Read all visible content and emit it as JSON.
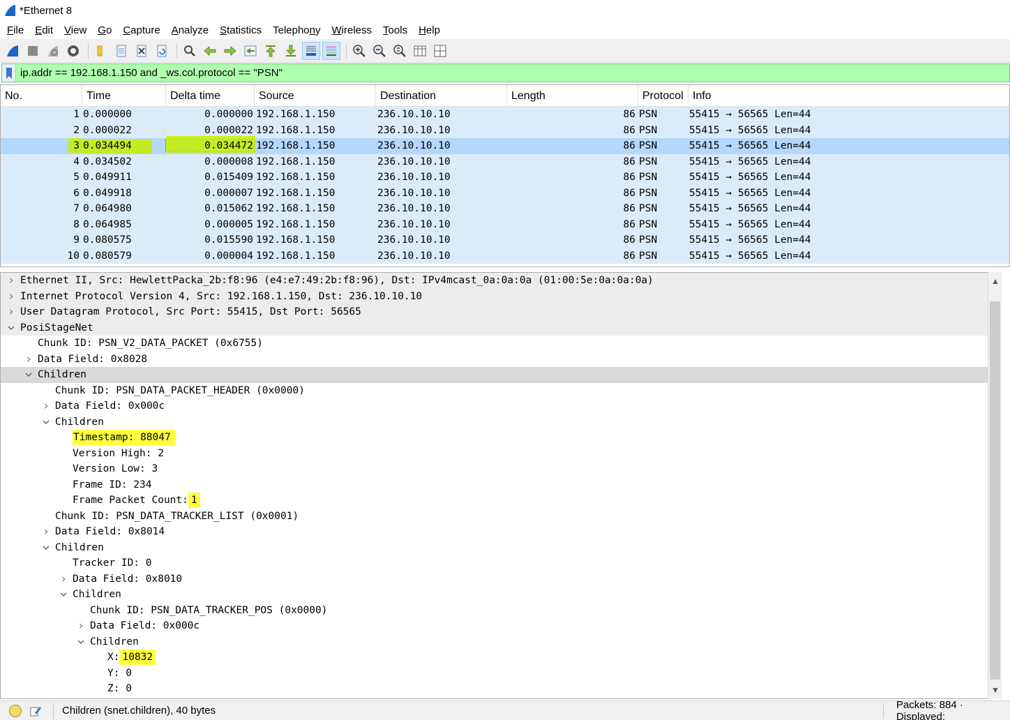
{
  "window": {
    "title": "*Ethernet 8"
  },
  "menu": [
    "File",
    "Edit",
    "View",
    "Go",
    "Capture",
    "Analyze",
    "Statistics",
    "Telephony",
    "Wireless",
    "Tools",
    "Help"
  ],
  "menu_accel": [
    "F",
    "E",
    "V",
    "G",
    "C",
    "A",
    "S",
    "n",
    "W",
    "T",
    "H"
  ],
  "toolbar": [
    "start-capture-icon",
    "stop-capture-icon",
    "restart-capture-icon",
    "capture-options-icon",
    "open-file-icon",
    "save-file-icon",
    "close-file-icon",
    "reload-file-icon",
    "find-packet-icon",
    "go-back-icon",
    "go-forward-icon",
    "go-to-packet-icon",
    "go-first-icon",
    "go-last-icon",
    "autoscroll-icon",
    "colorize-icon",
    "zoom-in-icon",
    "zoom-out-icon",
    "zoom-normal-icon",
    "resize-columns-icon",
    "expand-subtrees-icon"
  ],
  "filter": {
    "text": "ip.addr ==  192.168.1.150 and _ws.col.protocol == \"PSN\""
  },
  "packet_list": {
    "columns": [
      "No.",
      "Time",
      "Delta time",
      "Source",
      "Destination",
      "Length",
      "Protocol",
      "Info"
    ],
    "rows": [
      {
        "no": "1",
        "time": "0.000000",
        "delta": "0.000000",
        "src": "192.168.1.150",
        "dst": "236.10.10.10",
        "len": "86",
        "proto": "PSN",
        "info": "55415 → 56565 Len=44"
      },
      {
        "no": "2",
        "time": "0.000022",
        "delta": "0.000022",
        "src": "192.168.1.150",
        "dst": "236.10.10.10",
        "len": "86",
        "proto": "PSN",
        "info": "55415 → 56565 Len=44"
      },
      {
        "no": "3",
        "time": "0.034494",
        "delta": "0.034472",
        "src": "192.168.1.150",
        "dst": "236.10.10.10",
        "len": "86",
        "proto": "PSN",
        "info": "55415 → 56565 Len=44"
      },
      {
        "no": "4",
        "time": "0.034502",
        "delta": "0.000008",
        "src": "192.168.1.150",
        "dst": "236.10.10.10",
        "len": "86",
        "proto": "PSN",
        "info": "55415 → 56565 Len=44"
      },
      {
        "no": "5",
        "time": "0.049911",
        "delta": "0.015409",
        "src": "192.168.1.150",
        "dst": "236.10.10.10",
        "len": "86",
        "proto": "PSN",
        "info": "55415 → 56565 Len=44"
      },
      {
        "no": "6",
        "time": "0.049918",
        "delta": "0.000007",
        "src": "192.168.1.150",
        "dst": "236.10.10.10",
        "len": "86",
        "proto": "PSN",
        "info": "55415 → 56565 Len=44"
      },
      {
        "no": "7",
        "time": "0.064980",
        "delta": "0.015062",
        "src": "192.168.1.150",
        "dst": "236.10.10.10",
        "len": "86",
        "proto": "PSN",
        "info": "55415 → 56565 Len=44"
      },
      {
        "no": "8",
        "time": "0.064985",
        "delta": "0.000005",
        "src": "192.168.1.150",
        "dst": "236.10.10.10",
        "len": "86",
        "proto": "PSN",
        "info": "55415 → 56565 Len=44"
      },
      {
        "no": "9",
        "time": "0.080575",
        "delta": "0.015590",
        "src": "192.168.1.150",
        "dst": "236.10.10.10",
        "len": "86",
        "proto": "PSN",
        "info": "55415 → 56565 Len=44"
      },
      {
        "no": "10",
        "time": "0.080579",
        "delta": "0.000004",
        "src": "192.168.1.150",
        "dst": "236.10.10.10",
        "len": "86",
        "proto": "PSN",
        "info": "55415 → 56565 Len=44"
      }
    ],
    "selected_index": 2
  },
  "details": [
    {
      "text": "Ethernet II, Src: HewlettPacka_2b:f8:96 (e4:e7:49:2b:f8:96), Dst: IPv4mcast_0a:0a:0a (01:00:5e:0a:0a:0a)",
      "level": 0,
      "arrow": "collapsed",
      "top": true
    },
    {
      "text": "Internet Protocol Version 4, Src: 192.168.1.150, Dst: 236.10.10.10",
      "level": 0,
      "arrow": "collapsed",
      "top": true
    },
    {
      "text": "User Datagram Protocol, Src Port: 55415, Dst Port: 56565",
      "level": 0,
      "arrow": "collapsed",
      "top": true
    },
    {
      "text": "PosiStageNet",
      "level": 0,
      "arrow": "expanded",
      "top": true
    },
    {
      "text": "Chunk ID: PSN_V2_DATA_PACKET (0x6755)",
      "level": 1,
      "arrow": "none"
    },
    {
      "text": "Data Field: 0x8028",
      "level": 1,
      "arrow": "collapsed"
    },
    {
      "text": "Children",
      "level": 1,
      "arrow": "expanded",
      "selected": true
    },
    {
      "text": "Chunk ID: PSN_DATA_PACKET_HEADER (0x0000)",
      "level": 2,
      "arrow": "none"
    },
    {
      "text": "Data Field: 0x000c",
      "level": 2,
      "arrow": "collapsed"
    },
    {
      "text": "Children",
      "level": 2,
      "arrow": "expanded"
    },
    {
      "text": "Timestamp: 88047",
      "level": 3,
      "arrow": "none",
      "highlight": "full"
    },
    {
      "text": "Version High: 2",
      "level": 3,
      "arrow": "none"
    },
    {
      "text": "Version Low: 3",
      "level": 3,
      "arrow": "none"
    },
    {
      "text": "Frame ID: 234",
      "level": 3,
      "arrow": "none"
    },
    {
      "text": "Frame Packet Count: ",
      "value": "1",
      "level": 3,
      "arrow": "none",
      "highlight": "value"
    },
    {
      "text": "Chunk ID: PSN_DATA_TRACKER_LIST (0x0001)",
      "level": 2,
      "arrow": "none"
    },
    {
      "text": "Data Field: 0x8014",
      "level": 2,
      "arrow": "collapsed"
    },
    {
      "text": "Children",
      "level": 2,
      "arrow": "expanded"
    },
    {
      "text": "Tracker ID: 0",
      "level": 3,
      "arrow": "none"
    },
    {
      "text": "Data Field: 0x8010",
      "level": 3,
      "arrow": "collapsed"
    },
    {
      "text": "Children",
      "level": 3,
      "arrow": "expanded"
    },
    {
      "text": "Chunk ID: PSN_DATA_TRACKER_POS (0x0000)",
      "level": 4,
      "arrow": "none"
    },
    {
      "text": "Data Field: 0x000c",
      "level": 4,
      "arrow": "collapsed"
    },
    {
      "text": "Children",
      "level": 4,
      "arrow": "expanded"
    },
    {
      "text": "X: ",
      "value": "10832",
      "level": 5,
      "arrow": "none",
      "highlight": "value"
    },
    {
      "text": "Y: 0",
      "level": 5,
      "arrow": "none"
    },
    {
      "text": "Z: 0",
      "level": 5,
      "arrow": "none"
    }
  ],
  "status": {
    "field_info": "Children (snet.children), 40 bytes",
    "packets": "Packets: 884 · Displayed:"
  },
  "colors": {
    "filter_ok": "#afffaf",
    "row_bg": "#dcebfa",
    "row_selected": "#b4d7fb",
    "marker_yellow": "#ffff3c",
    "marker_green": "#c6f000"
  }
}
